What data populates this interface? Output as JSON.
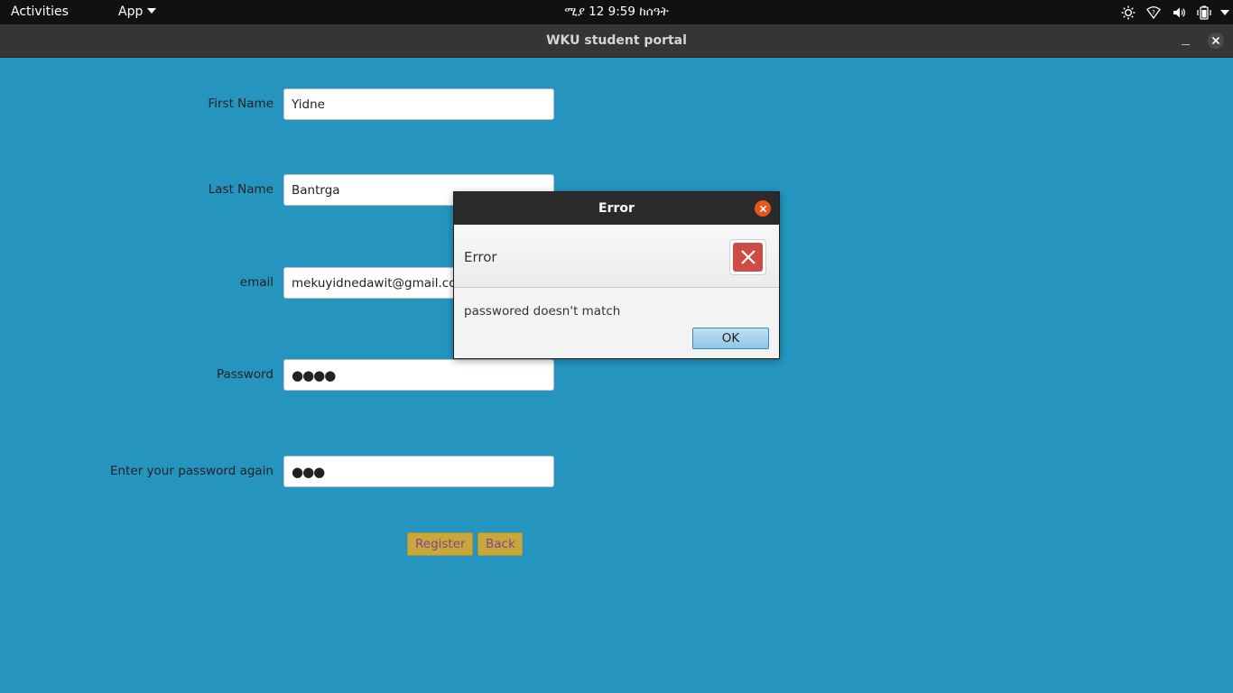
{
  "topbar": {
    "activities": "Activities",
    "app_menu": "App",
    "clock": "ሚያ  12   9:59 ከሰዓት",
    "tray_icons": [
      "brightness-icon",
      "wifi-icon",
      "volume-icon",
      "battery-icon"
    ]
  },
  "window": {
    "title": "WKU student portal"
  },
  "form": {
    "first_name_label": "First Name",
    "first_name_value": "Yidne",
    "last_name_label": "Last Name",
    "last_name_value": "Bantrga",
    "email_label": "email",
    "email_value": "mekuyidnedawit@gmail.com",
    "password_label": "Password",
    "password_value": "●●●●",
    "password_again_label": "Enter your password again",
    "password_again_value": "●●●",
    "register_button": "Register",
    "back_button": "Back"
  },
  "dialog": {
    "title": "Error",
    "header": "Error",
    "message": "passwored doesn't match",
    "ok_button": "OK"
  },
  "colors": {
    "background": "#2595c0",
    "button": "#c8a83b",
    "button_text": "#8a3f8f",
    "error_icon": "#cf4b45",
    "close_accent": "#e95420"
  }
}
